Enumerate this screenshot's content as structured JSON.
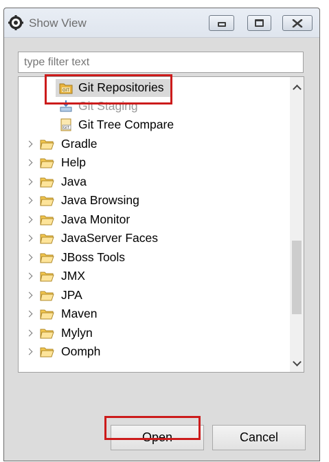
{
  "window": {
    "title": "Show View",
    "icon": "eclipse-gear-icon"
  },
  "filter": {
    "placeholder": "type filter text",
    "value": ""
  },
  "tree": {
    "children_of_git": [
      {
        "label": "Git Repositories",
        "icon": "git-repositories-icon",
        "selected": true,
        "highlighted": true
      },
      {
        "label": "Git Staging",
        "icon": "git-staging-icon",
        "selected": false
      },
      {
        "label": "Git Tree Compare",
        "icon": "git-tree-compare-icon",
        "selected": false
      }
    ],
    "categories": [
      {
        "label": "Gradle"
      },
      {
        "label": "Help"
      },
      {
        "label": "Java"
      },
      {
        "label": "Java Browsing"
      },
      {
        "label": "Java Monitor"
      },
      {
        "label": "JavaServer Faces"
      },
      {
        "label": "JBoss Tools"
      },
      {
        "label": "JMX"
      },
      {
        "label": "JPA"
      },
      {
        "label": "Maven"
      },
      {
        "label": "Mylyn"
      },
      {
        "label": "Oomph"
      }
    ]
  },
  "buttons": {
    "open": "Open",
    "cancel": "Cancel"
  },
  "colors": {
    "highlight_red": "#cc1b1b",
    "folder_yellow": "#f3c74e",
    "selection_gray": "#d9d9d9"
  }
}
